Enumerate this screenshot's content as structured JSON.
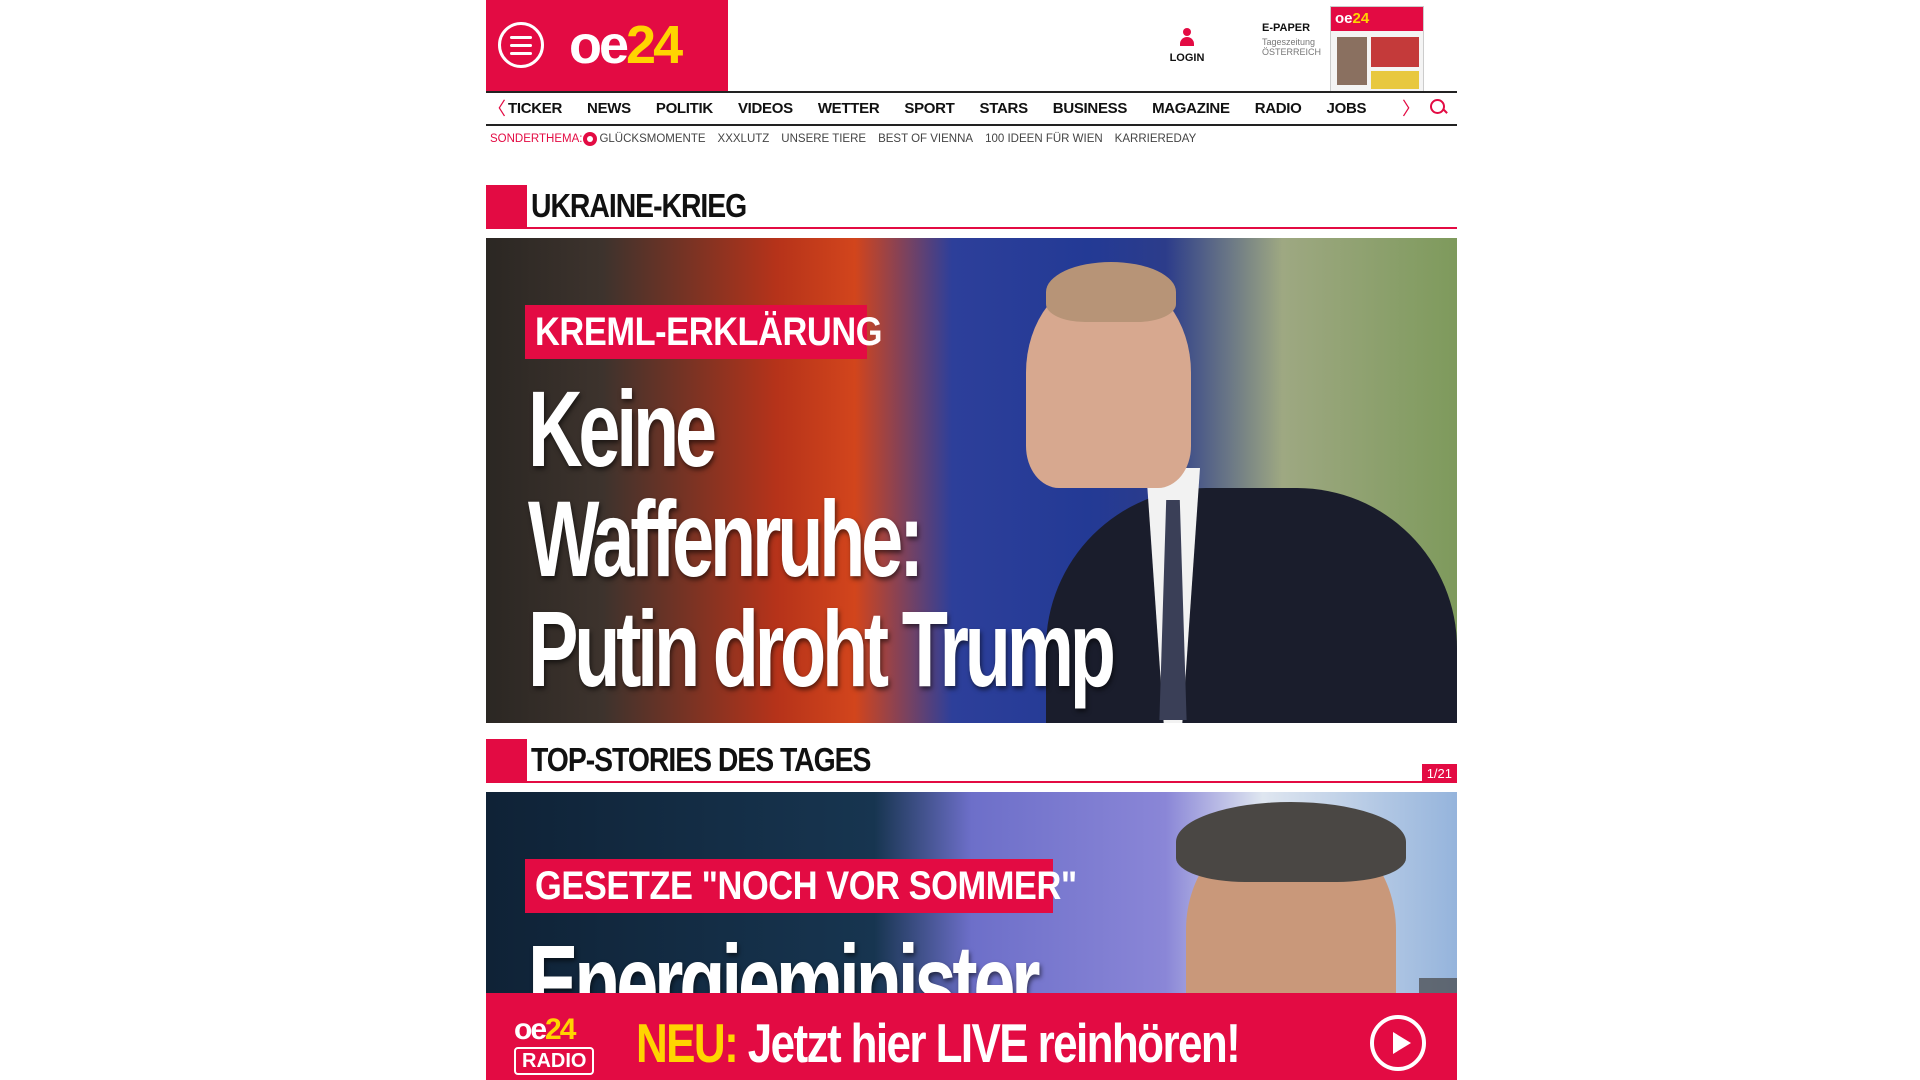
{
  "header": {
    "logo": {
      "oe": "oe",
      "n24": "24"
    },
    "login_label": "LOGIN",
    "epaper": {
      "title": "E-PAPER",
      "subtitle": "Tageszeitung",
      "region": "ÖSTERREICH",
      "thumb_logo_oe": "oe",
      "thumb_logo_24": "24"
    }
  },
  "nav": {
    "items": [
      "TICKER",
      "NEWS",
      "POLITIK",
      "VIDEOS",
      "WETTER",
      "SPORT",
      "STARS",
      "BUSINESS",
      "MAGAZINE",
      "RADIO",
      "JOBS"
    ],
    "left_arrow": "〈",
    "right_arrow": "〉"
  },
  "subnav": {
    "label": "SONDERTHEMA:",
    "items": [
      "GLÜCKSMOMENTE",
      "XXXLUTZ",
      "UNSERE TIERE",
      "BEST OF VIENNA",
      "100 IDEEN FÜR WIEN",
      "KARRIEREDAY"
    ]
  },
  "sections": {
    "ukraine": {
      "title": "UKRAINE-KRIEG",
      "kicker": "KREML-ERKLÄRUNG",
      "headline": [
        "Keine",
        "Waffenruhe:",
        "Putin droht Trump"
      ]
    },
    "top_stories": {
      "title": "TOP-STORIES DES TAGES",
      "counter": "1/21",
      "kicker": "GESETZE \"NOCH VOR SOMMER\"",
      "headline": [
        "Energieminister"
      ]
    }
  },
  "radio_banner": {
    "logo_top_oe": "oe",
    "logo_top_24": "24",
    "logo_bottom": "RADIO",
    "neu": "NEU:",
    "text": " Jetzt hier LIVE reinhören!"
  },
  "colors": {
    "brand_red": "#e30b43",
    "brand_yellow": "#ffd400"
  }
}
